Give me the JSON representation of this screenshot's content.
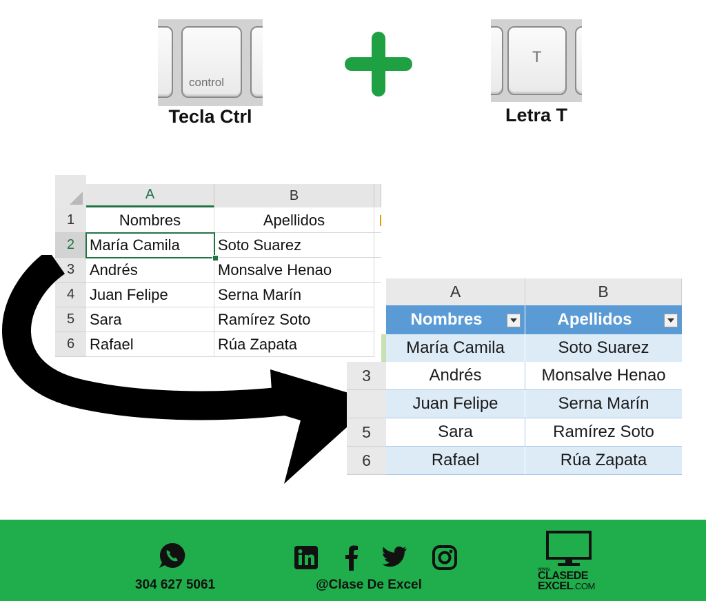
{
  "shortcut": {
    "key1_cap": "control",
    "key1_caption": "Tecla Ctrl",
    "key2_cap": "T",
    "key2_caption": "Letra T",
    "plus_color": "#1fa043"
  },
  "sheet_before": {
    "col_headers": [
      "A",
      "B"
    ],
    "row_numbers": [
      "1",
      "2",
      "3",
      "4",
      "5",
      "6"
    ],
    "header_row": [
      "Nombres",
      "Apellidos"
    ],
    "rows": [
      [
        "María Camila",
        "Soto Suarez"
      ],
      [
        "Andrés",
        "Monsalve Henao"
      ],
      [
        "Juan Felipe",
        "Serna Marín"
      ],
      [
        "Sara",
        "Ramírez Soto"
      ],
      [
        "Rafael",
        "Rúa Zapata"
      ]
    ]
  },
  "sheet_after": {
    "col_headers": [
      "A",
      "B"
    ],
    "header_row": [
      "Nombres",
      "Apellidos"
    ],
    "row_numbers": [
      "3",
      "",
      "5",
      "6"
    ],
    "rows": [
      [
        "María Camila",
        "Soto Suarez"
      ],
      [
        "Andrés",
        "Monsalve Henao"
      ],
      [
        "Juan Felipe",
        "Serna Marín"
      ],
      [
        "Sara",
        "Ramírez Soto"
      ],
      [
        "Rafael",
        "Rúa Zapata"
      ]
    ],
    "header_color": "#5b9bd5",
    "band_color": "#ddebf7"
  },
  "footer": {
    "phone": "304 627 5061",
    "handle": "@Clase De Excel",
    "logo_www": "www.",
    "logo_line1": "CLASEDE",
    "logo_line2": "EXCEL",
    "logo_suffix": ".COM",
    "icons": [
      "whatsapp-icon",
      "linkedin-icon",
      "facebook-icon",
      "twitter-icon",
      "instagram-icon",
      "monitor-icon"
    ],
    "bg_color": "#1fae4b"
  }
}
